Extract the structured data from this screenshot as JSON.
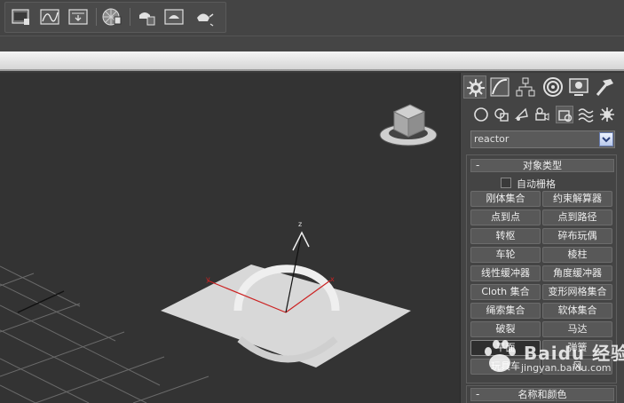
{
  "toolbar": {
    "buttons": [
      {
        "icon": "render-setup-icon"
      },
      {
        "icon": "curve-editor-icon"
      },
      {
        "icon": "render-to-texture-icon"
      },
      {
        "icon": "material-editor-icon"
      },
      {
        "icon": "render-frame-icon"
      },
      {
        "icon": "quick-render-icon"
      },
      {
        "icon": "activeshade-teapot-icon"
      }
    ]
  },
  "viewport": {
    "axis_labels": {
      "z": "z",
      "x": "x",
      "y": "y"
    },
    "colors": {
      "background": "#333333",
      "grid": "#6a6a6a",
      "plane": "#d8d8d8",
      "ring": "#eeeeee",
      "axis_red": "#cc2222"
    }
  },
  "command_panel": {
    "tabs": [
      {
        "icon": "create-tab-icon",
        "active": true
      },
      {
        "icon": "modify-tab-icon",
        "active": false
      },
      {
        "icon": "hierarchy-tab-icon",
        "active": false
      },
      {
        "icon": "motion-tab-icon",
        "active": false
      },
      {
        "icon": "display-tab-icon",
        "active": false
      },
      {
        "icon": "utilities-tab-icon",
        "active": false
      }
    ],
    "subtabs": [
      {
        "icon": "geometry-icon",
        "active": false
      },
      {
        "icon": "shapes-icon",
        "active": false
      },
      {
        "icon": "lights-icon",
        "active": false
      },
      {
        "icon": "cameras-icon",
        "active": false
      },
      {
        "icon": "helpers-icon",
        "active": true
      },
      {
        "icon": "space-warps-icon",
        "active": false
      },
      {
        "icon": "systems-icon",
        "active": false
      }
    ],
    "category_dropdown": {
      "value": "reactor"
    },
    "object_type": {
      "collapse": "-",
      "title": "对象类型",
      "auto_grid_label": "自动栅格",
      "buttons": [
        [
          "刚体集合",
          "约束解算器"
        ],
        [
          "点到点",
          "点到路径"
        ],
        [
          "转枢",
          "碎布玩偶"
        ],
        [
          "车轮",
          "棱柱"
        ],
        [
          "线性缓冲器",
          "角度缓冲器"
        ],
        [
          "Cloth 集合",
          "变形网格集合"
        ],
        [
          "绳索集合",
          "软体集合"
        ],
        [
          "破裂",
          "马达"
        ],
        [
          "平面",
          "弹簧"
        ],
        [
          "玩具车",
          "风"
        ]
      ],
      "pressed": "平面"
    },
    "name_color": {
      "collapse": "-",
      "title": "名称和颜色"
    }
  },
  "watermark": {
    "main": "Baidu 经验",
    "sub": "jingyan.baidu.com"
  }
}
